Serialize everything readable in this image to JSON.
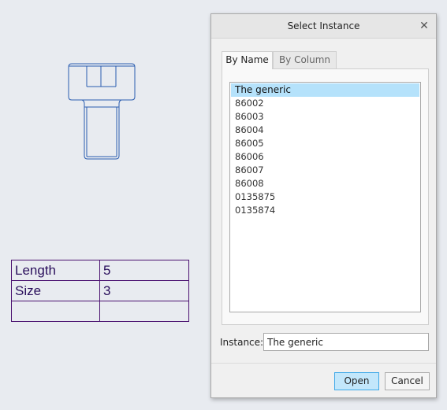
{
  "params": [
    {
      "name": "Length",
      "value": "5"
    },
    {
      "name": "Size",
      "value": "3"
    },
    {
      "name": "",
      "value": ""
    }
  ],
  "dialog": {
    "title": "Select Instance",
    "close_icon": "close-icon",
    "tabs": [
      {
        "label": "By Name",
        "active": true
      },
      {
        "label": "By Column",
        "active": false
      }
    ],
    "instances": [
      "The generic",
      "86002",
      "86003",
      "86004",
      "86005",
      "86006",
      "86007",
      "86008",
      "0135875",
      "0135874"
    ],
    "selected_index": 0,
    "instance_label": "Instance:",
    "instance_value": "The generic",
    "open_label": "Open",
    "cancel_label": "Cancel"
  },
  "colors": {
    "background": "#e8ebf0",
    "drawing_stroke": "#2a5db0",
    "table_border": "#4a1170",
    "selection": "#b5e2fb",
    "primary_button": "#c3e7fb"
  }
}
